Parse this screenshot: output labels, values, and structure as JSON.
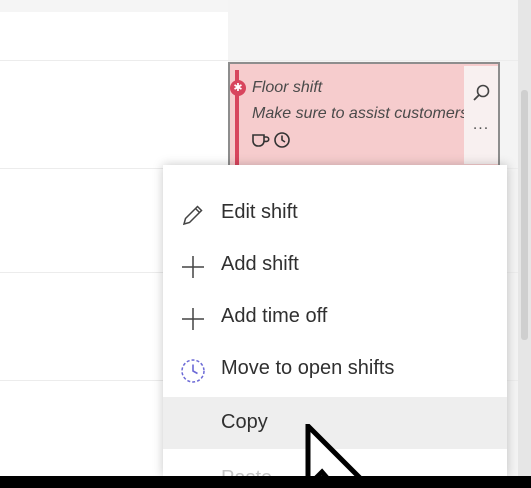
{
  "shift_card": {
    "title": "Floor shift",
    "note": "Make sure to assist customers",
    "theme_color": "#d8455d",
    "background_color": "#f6cccd",
    "more_label": "..."
  },
  "context_menu": {
    "items": [
      {
        "label": "Edit shift",
        "icon": "pencil-icon"
      },
      {
        "label": "Add shift",
        "icon": "plus-icon"
      },
      {
        "label": "Add time off",
        "icon": "plus-icon"
      },
      {
        "label": "Move to open shifts",
        "icon": "clock-icon"
      },
      {
        "label": "Copy",
        "icon": "none",
        "state": "hovered"
      },
      {
        "label": "Paste",
        "icon": "none",
        "state": "disabled"
      }
    ]
  },
  "colors": {
    "menu_hover": "#eeeeee",
    "accent_purple": "#6b69d6"
  }
}
